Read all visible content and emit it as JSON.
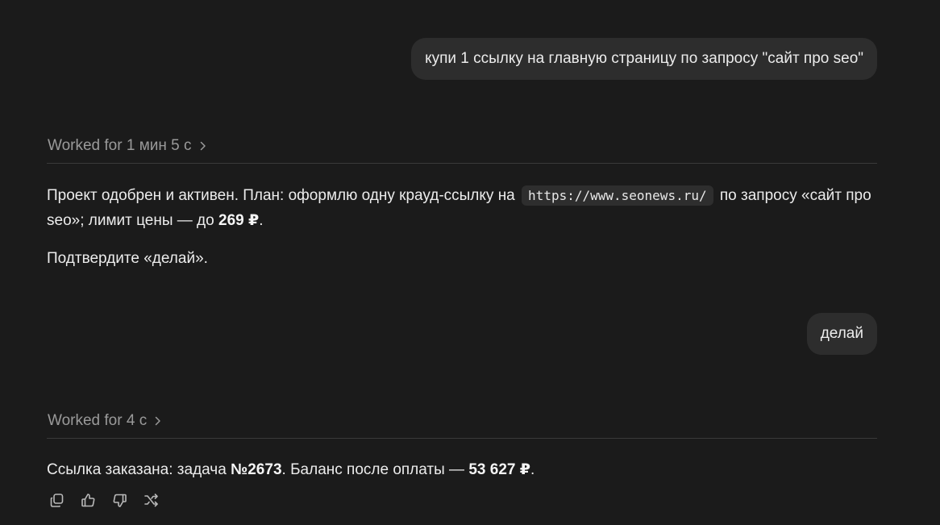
{
  "messages": {
    "user_1": "купи 1 ссылку на главную страницу по запросу \"сайт про seo\"",
    "worked_1": "Worked for 1 мин 5 с",
    "assistant_1": {
      "part_a": "Проект одобрен и активен. План: оформлю одну крауд-ссылку на",
      "url": "https://www.seonews.ru/",
      "part_b": "по запросу «сайт про seo»; лимит цены — до",
      "price": "269 ₽",
      "part_c": "."
    },
    "assistant_2": "Подтвердите «делай».",
    "user_2": "делай",
    "worked_2": "Worked for 4 с",
    "assistant_3": {
      "part_a": "Ссылка заказана: задача",
      "task": "№2673",
      "part_b": ". Баланс после оплаты —",
      "balance": "53 627 ₽",
      "part_c": "."
    }
  },
  "actions": {
    "icons": [
      "copy-icon",
      "thumbs-up-icon",
      "thumbs-down-icon",
      "share-icon"
    ]
  }
}
